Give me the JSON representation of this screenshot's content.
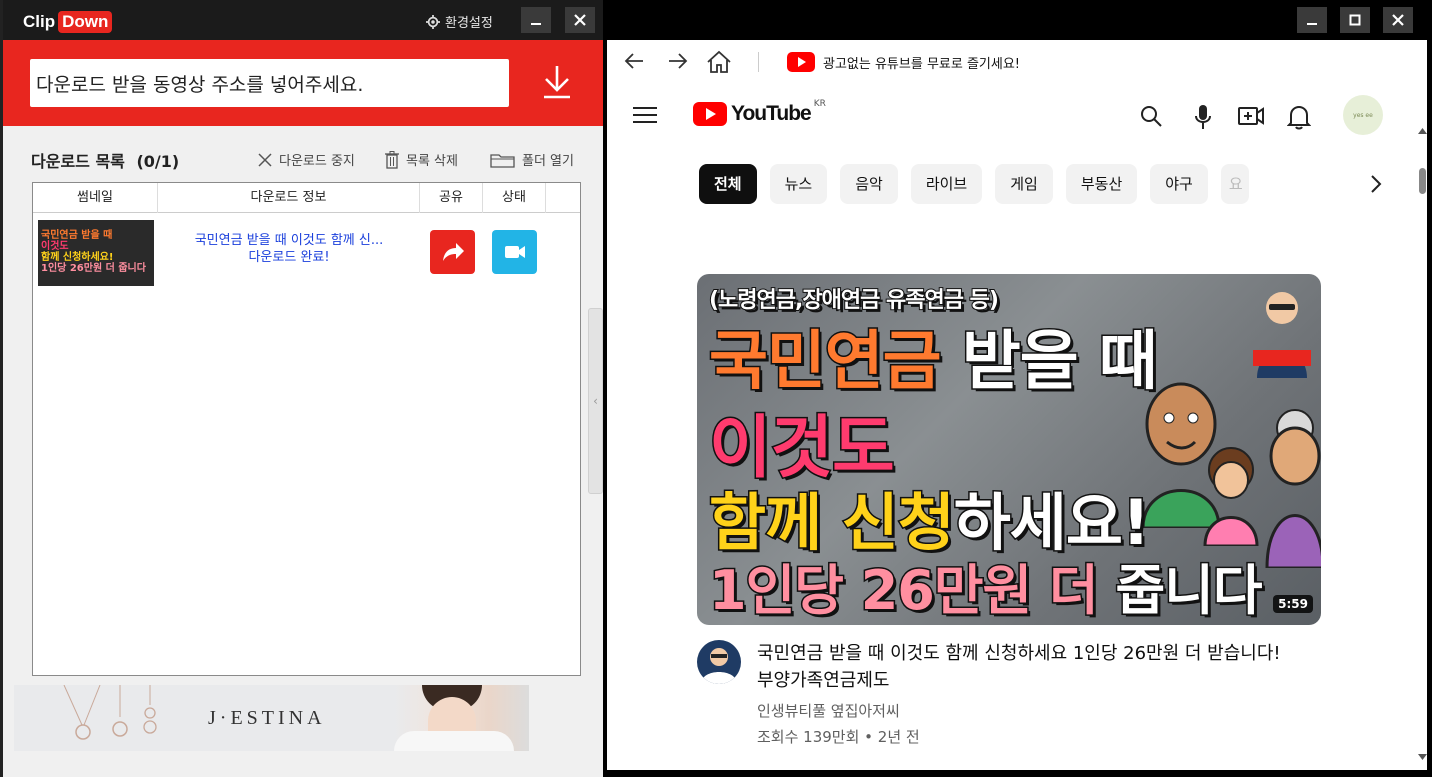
{
  "clipdown": {
    "logo": {
      "clip": "Clip",
      "down": "Down"
    },
    "settings_label": "환경설정",
    "url_placeholder": "다운로드 받을 동영상 주소를 넣어주세요.",
    "list_title": "다운로드 목록",
    "list_count": "(0/1)",
    "actions": {
      "stop": "다운로드 중지",
      "delete": "목록 삭제",
      "open_folder": "폴더 열기"
    },
    "columns": [
      "썸네일",
      "다운로드 정보",
      "공유",
      "상태"
    ],
    "rows": [
      {
        "thumb_lines": [
          "국민연금 받을 때",
          "이것도",
          "함께 신청하세요!",
          "1인당 26만원 더 줍니다"
        ],
        "title": "국민연금 받을 때 이것도 함께 신...",
        "status": "다운로드 완료!"
      }
    ],
    "banner_brand": "J·ESTINA",
    "colors": {
      "accent": "#e8261f",
      "status": "#22b4e6",
      "link": "#1a3fdc"
    }
  },
  "browser": {
    "promo_text": "광고없는 유튜브를 무료로 즐기세요!"
  },
  "youtube": {
    "logo_text": "YouTube",
    "region": "KR",
    "avatar_text": "yes ee",
    "chips": [
      "전체",
      "뉴스",
      "음악",
      "라이브",
      "게임",
      "부동산",
      "야구",
      "요"
    ],
    "video": {
      "thumb_line0": "(노령연금,장애연금 유족연금 등)",
      "thumb_line1a": "국민연금",
      "thumb_line1b": "받을 때",
      "thumb_line2": "이것도",
      "thumb_line3a": "함께 신청",
      "thumb_line3b": "하세요!",
      "thumb_line4a": "1인당 26만원 더",
      "thumb_line4b": "줍니다",
      "duration": "5:59",
      "title": "국민연금 받을 때 이것도 함께 신청하세요 1인당 26만원 더 받습니다! 부양가족연금제도",
      "channel": "인생뷰티풀 옆집아저씨",
      "meta": "조회수 139만회 • 2년 전"
    }
  }
}
